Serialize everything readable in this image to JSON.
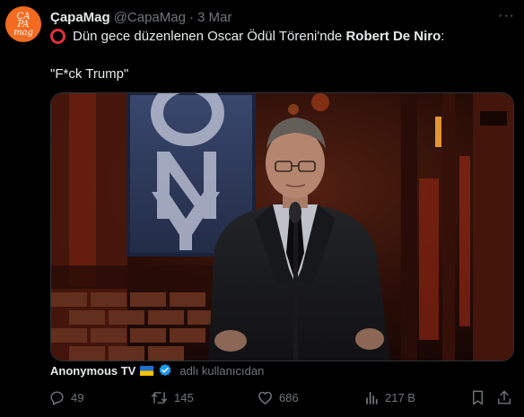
{
  "tweet": {
    "avatar_text": "ÇAPA\nmag",
    "display_name": "ÇapaMag",
    "handle": "@CapaMag",
    "separator": "·",
    "date": "3 Mar",
    "more_label": "···",
    "text_line1_prefix": "Dün gece düzenlenen Oscar Ödül Töreni'nde ",
    "text_line1_bold": "Robert De Niro",
    "text_line1_suffix": ":",
    "text_line2": "\"F*ck Trump\""
  },
  "media_credit": {
    "name": "Anonymous TV",
    "suffix": "adlı kullanıcıdan"
  },
  "actions": {
    "replies": "49",
    "reposts": "145",
    "likes": "686",
    "views": "217 B"
  },
  "colors": {
    "background": "#000000",
    "text": "#e7e9ea",
    "muted": "#71767b",
    "avatar": "#f26b21",
    "verified": "#1d9bf0",
    "ring": "#e0313a"
  },
  "icons": [
    "more-icon",
    "red-circle-icon",
    "ukraine-flag-icon",
    "verified-badge-icon",
    "reply-icon",
    "repost-icon",
    "like-icon",
    "views-icon",
    "bookmark-icon",
    "share-icon"
  ]
}
